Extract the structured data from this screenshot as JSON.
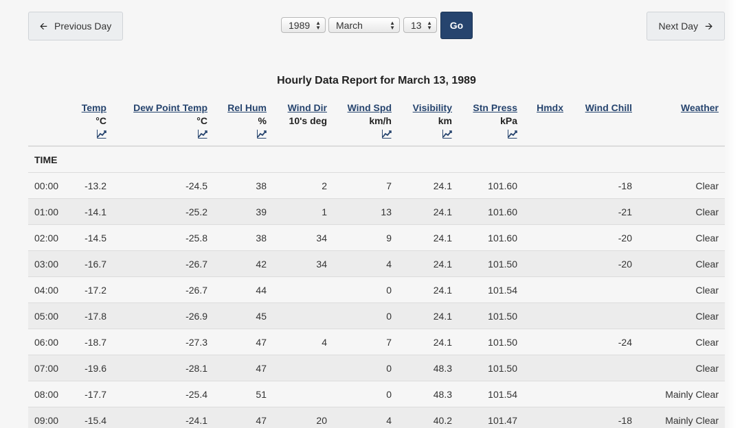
{
  "nav": {
    "prev_label": "Previous Day",
    "next_label": "Next Day",
    "go_label": "Go",
    "year": "1989",
    "month": "March",
    "day": "13"
  },
  "title": "Hourly Data Report for March 13, 1989",
  "columns": [
    {
      "key": "temp",
      "label": "Temp",
      "unit": "°C",
      "chart": true
    },
    {
      "key": "dew",
      "label": "Dew Point Temp",
      "unit": "°C",
      "chart": true
    },
    {
      "key": "hum",
      "label": "Rel Hum",
      "unit": "%",
      "chart": true
    },
    {
      "key": "wdir",
      "label": "Wind Dir",
      "unit": "10's deg",
      "chart": false
    },
    {
      "key": "wspd",
      "label": "Wind Spd",
      "unit": "km/h",
      "chart": true
    },
    {
      "key": "vis",
      "label": "Visibility",
      "unit": "km",
      "chart": true
    },
    {
      "key": "press",
      "label": "Stn Press",
      "unit": "kPa",
      "chart": true
    },
    {
      "key": "hmdx",
      "label": "Hmdx",
      "unit": "",
      "chart": false
    },
    {
      "key": "chill",
      "label": "Wind Chill",
      "unit": "",
      "chart": false
    },
    {
      "key": "weather",
      "label": "Weather",
      "unit": "",
      "chart": false
    }
  ],
  "time_header": "TIME",
  "rows": [
    {
      "time": "00:00",
      "temp": "-13.2",
      "dew": "-24.5",
      "hum": "38",
      "wdir": "2",
      "wspd": "7",
      "vis": "24.1",
      "press": "101.60",
      "hmdx": "",
      "chill": "-18",
      "weather": "Clear"
    },
    {
      "time": "01:00",
      "temp": "-14.1",
      "dew": "-25.2",
      "hum": "39",
      "wdir": "1",
      "wspd": "13",
      "vis": "24.1",
      "press": "101.60",
      "hmdx": "",
      "chill": "-21",
      "weather": "Clear"
    },
    {
      "time": "02:00",
      "temp": "-14.5",
      "dew": "-25.8",
      "hum": "38",
      "wdir": "34",
      "wspd": "9",
      "vis": "24.1",
      "press": "101.60",
      "hmdx": "",
      "chill": "-20",
      "weather": "Clear"
    },
    {
      "time": "03:00",
      "temp": "-16.7",
      "dew": "-26.7",
      "hum": "42",
      "wdir": "34",
      "wspd": "4",
      "vis": "24.1",
      "press": "101.50",
      "hmdx": "",
      "chill": "-20",
      "weather": "Clear"
    },
    {
      "time": "04:00",
      "temp": "-17.2",
      "dew": "-26.7",
      "hum": "44",
      "wdir": "",
      "wspd": "0",
      "vis": "24.1",
      "press": "101.54",
      "hmdx": "",
      "chill": "",
      "weather": "Clear"
    },
    {
      "time": "05:00",
      "temp": "-17.8",
      "dew": "-26.9",
      "hum": "45",
      "wdir": "",
      "wspd": "0",
      "vis": "24.1",
      "press": "101.50",
      "hmdx": "",
      "chill": "",
      "weather": "Clear"
    },
    {
      "time": "06:00",
      "temp": "-18.7",
      "dew": "-27.3",
      "hum": "47",
      "wdir": "4",
      "wspd": "7",
      "vis": "24.1",
      "press": "101.50",
      "hmdx": "",
      "chill": "-24",
      "weather": "Clear"
    },
    {
      "time": "07:00",
      "temp": "-19.6",
      "dew": "-28.1",
      "hum": "47",
      "wdir": "",
      "wspd": "0",
      "vis": "48.3",
      "press": "101.50",
      "hmdx": "",
      "chill": "",
      "weather": "Clear"
    },
    {
      "time": "08:00",
      "temp": "-17.7",
      "dew": "-25.4",
      "hum": "51",
      "wdir": "",
      "wspd": "0",
      "vis": "48.3",
      "press": "101.54",
      "hmdx": "",
      "chill": "",
      "weather": "Mainly Clear"
    },
    {
      "time": "09:00",
      "temp": "-15.4",
      "dew": "-24.1",
      "hum": "47",
      "wdir": "20",
      "wspd": "4",
      "vis": "40.2",
      "press": "101.47",
      "hmdx": "",
      "chill": "-18",
      "weather": "Mainly Clear"
    }
  ],
  "colors": {
    "primary": "#26446e",
    "link": "#26446e",
    "row_alt": "#ececec"
  }
}
